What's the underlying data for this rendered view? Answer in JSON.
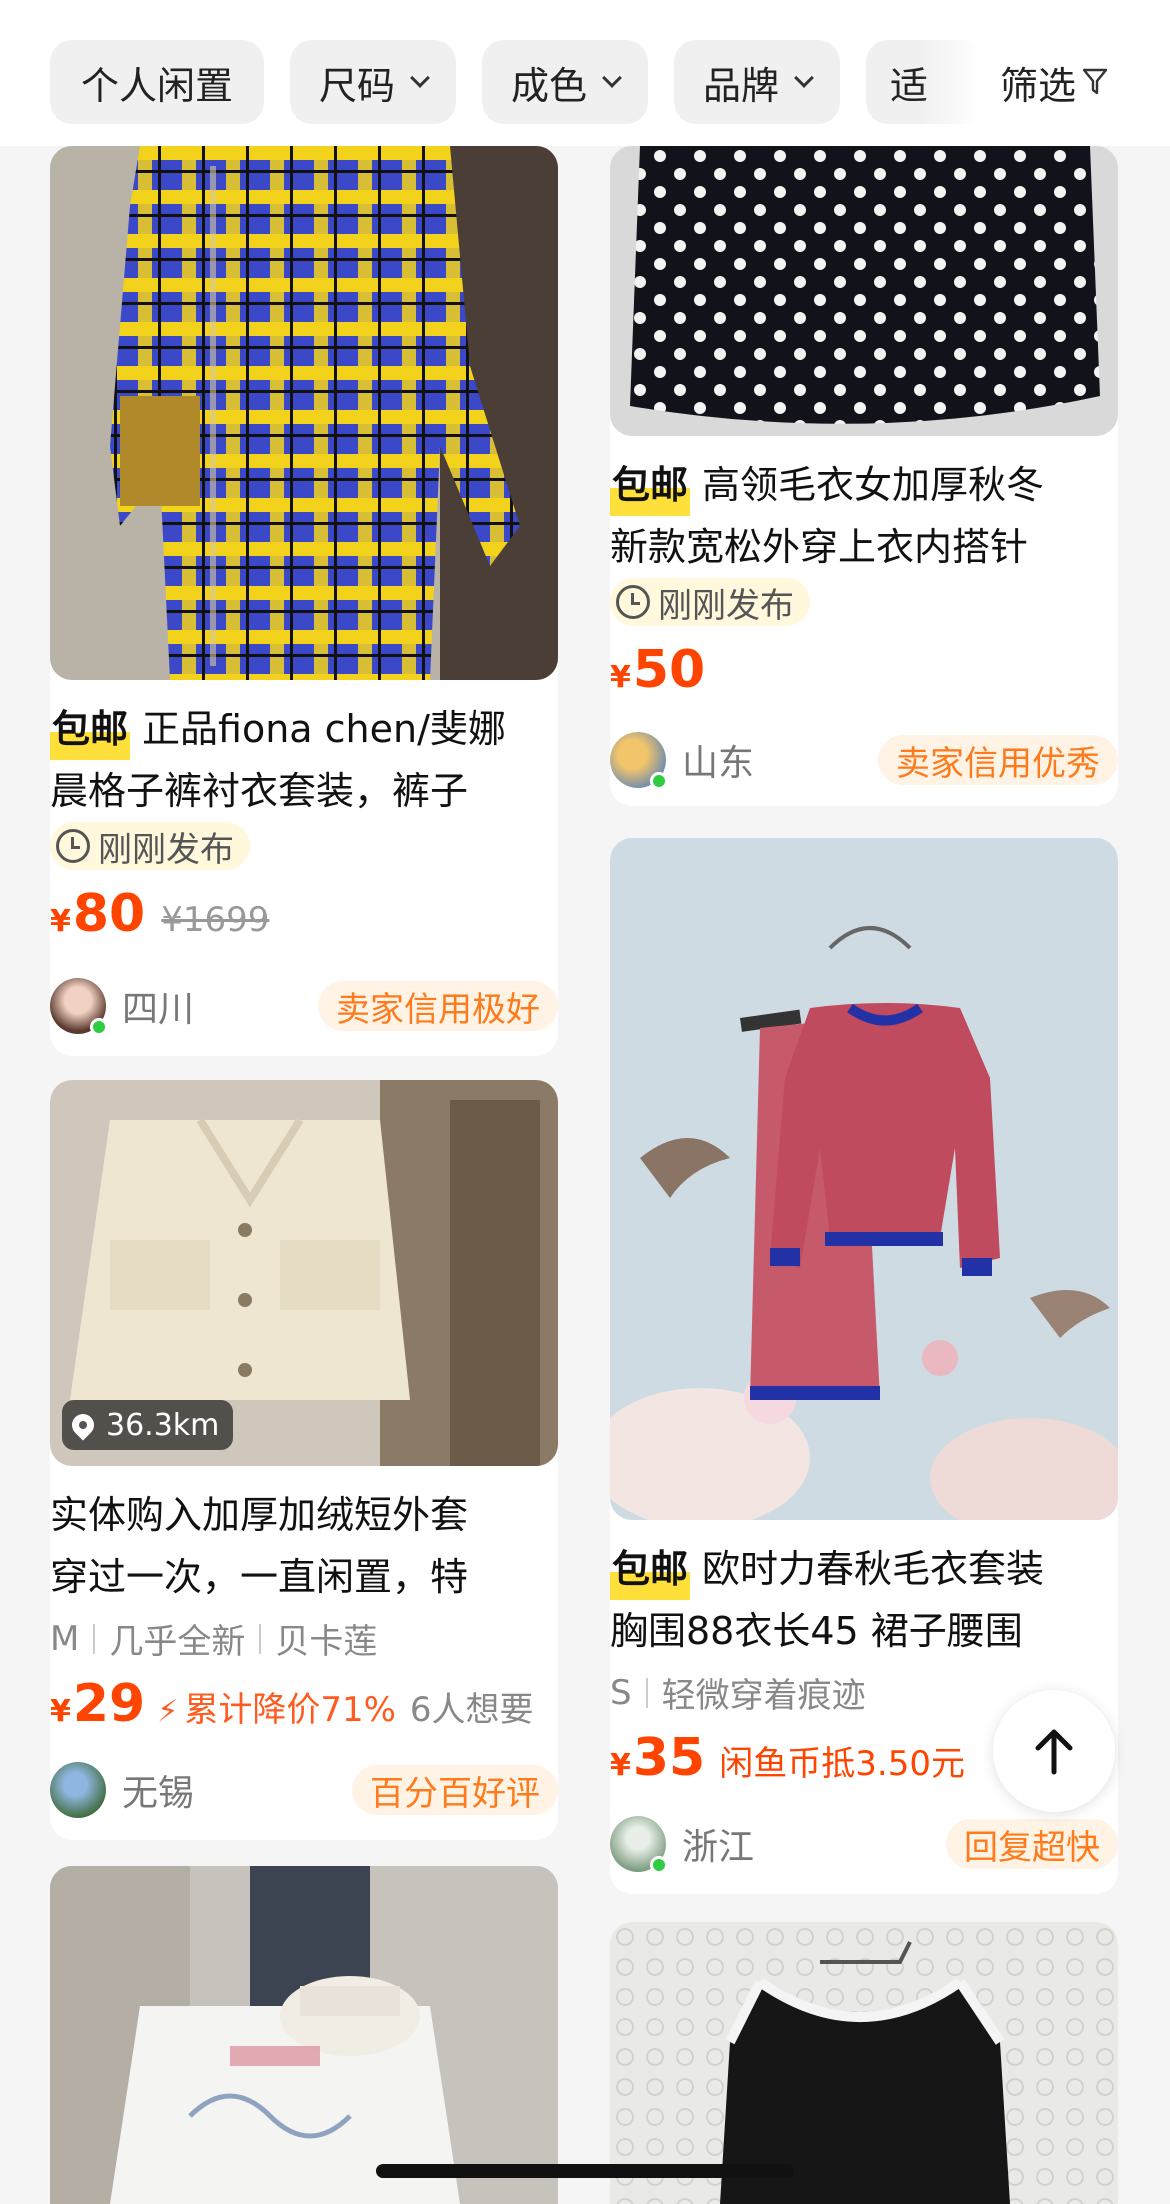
{
  "filters": {
    "chips": [
      {
        "label": "个人闲置",
        "has_dropdown": false
      },
      {
        "label": "尺码",
        "has_dropdown": true
      },
      {
        "label": "成色",
        "has_dropdown": true
      },
      {
        "label": "品牌",
        "has_dropdown": true
      },
      {
        "label": "适",
        "has_dropdown": false
      }
    ],
    "filter_label": "筛选"
  },
  "left_column": [
    {
      "free_shipping": "包邮",
      "title_lines": [
        "正品fiona chen/斐娜",
        "晨格子裤衬衣套装，裤子"
      ],
      "time_badge": "刚刚发布",
      "currency": "¥",
      "price": "80",
      "original_price": "¥1699",
      "location": "四川",
      "credit": "卖家信用极好"
    },
    {
      "distance": "36.3km",
      "title_lines": [
        "实体购入加厚加绒短外套",
        "穿过一次，一直闲置，特"
      ],
      "tags": [
        "M",
        "几乎全新",
        "贝卡莲"
      ],
      "currency": "¥",
      "price": "29",
      "discount": "累计降价71%",
      "wants": "6人想要",
      "location": "无锡",
      "credit": "百分百好评"
    }
  ],
  "right_column": [
    {
      "free_shipping": "包邮",
      "title_lines": [
        "高领毛衣女加厚秋冬",
        "新款宽松外穿上衣内搭针"
      ],
      "time_badge": "刚刚发布",
      "currency": "¥",
      "price": "50",
      "location": "山东",
      "credit": "卖家信用优秀"
    },
    {
      "free_shipping": "包邮",
      "title_lines": [
        "欧时力春秋毛衣套装",
        "胸围88衣长45 裙子腰围"
      ],
      "tags": [
        "S",
        "轻微穿着痕迹"
      ],
      "currency": "¥",
      "price": "35",
      "coin": "闲鱼币抵3.50元",
      "location": "浙江",
      "credit": "回复超快"
    }
  ],
  "colors": {
    "price": "#ff4400",
    "credit_text": "#ff7a1a",
    "credit_bg": "#fff3e6",
    "highlight": "#ffdf3a",
    "online": "#2ecc40"
  },
  "icons": [
    "chevron-down-icon",
    "funnel-icon",
    "clock-icon",
    "pin-icon",
    "bolt-icon",
    "arrow-up-icon"
  ]
}
